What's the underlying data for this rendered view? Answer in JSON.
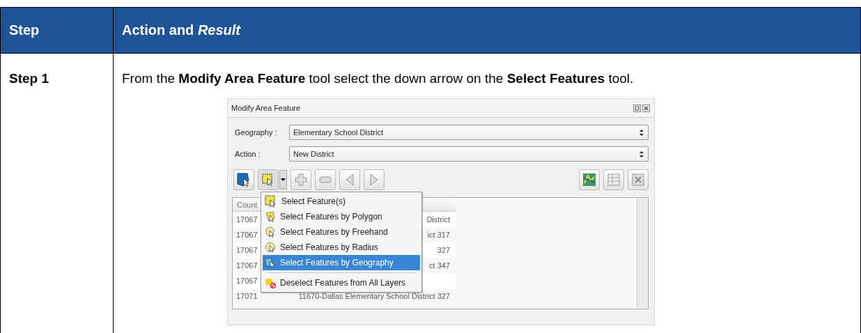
{
  "table": {
    "columns": [
      {
        "label": "Step"
      },
      {
        "label": "Action and *Result*"
      }
    ],
    "rows": [
      {
        "step": "Step 1",
        "instruction": "From the **Modify Area Feature** tool select the down arrow on the **Select Features** tool.",
        "screenshot": {
          "title": "Modify Area Feature",
          "fields": [
            {
              "label": "Geography :",
              "value": "Elementary School District"
            },
            {
              "label": "Action :",
              "value": "New District"
            }
          ],
          "results": {
            "columns": [
              "Count"
            ],
            "rows": [
              {
                "county": "17067",
                "name": "District"
              },
              {
                "county": "17067",
                "name": "ict 317"
              },
              {
                "county": "17067",
                "name": "327"
              },
              {
                "county": "17067",
                "name": "ct 347"
              },
              {
                "county": "17067"
              },
              {
                "county": "17071",
                "name": "11670-Dallas Elementary School District 327"
              }
            ]
          },
          "menu": [
            {
              "kind": "item",
              "label": "Select Feature(s)",
              "selected": false
            },
            {
              "kind": "item",
              "label": "Select Features by Polygon",
              "selected": false
            },
            {
              "kind": "item",
              "label": "Select Features by Freehand",
              "selected": false
            },
            {
              "kind": "item",
              "label": "Select Features by Radius",
              "selected": false
            },
            {
              "kind": "item",
              "label": "Select Features by Geography",
              "selected": true
            },
            {
              "kind": "separator"
            },
            {
              "kind": "item",
              "label": "Deselect Features from All Layers",
              "selected": false
            }
          ]
        }
      }
    ]
  }
}
